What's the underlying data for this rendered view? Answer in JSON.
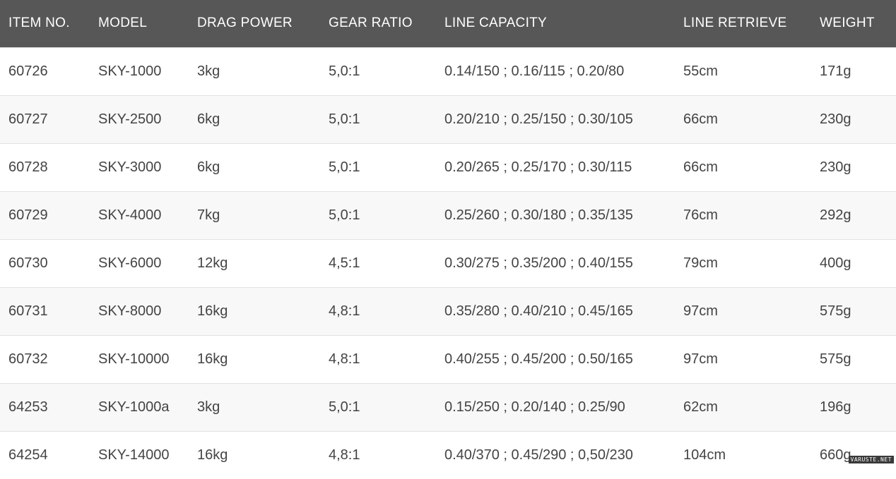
{
  "table": {
    "headers": [
      "ITEM NO.",
      "MODEL",
      "DRAG POWER",
      "GEAR RATIO",
      "LINE CAPACITY",
      "LINE RETRIEVE",
      "WEIGHT"
    ],
    "rows": [
      [
        "60726",
        "SKY-1000",
        "3kg",
        "5,0:1",
        "0.14/150 ; 0.16/115 ; 0.20/80",
        "55cm",
        "171g"
      ],
      [
        "60727",
        "SKY-2500",
        "6kg",
        "5,0:1",
        "0.20/210 ; 0.25/150 ; 0.30/105",
        "66cm",
        "230g"
      ],
      [
        "60728",
        "SKY-3000",
        "6kg",
        "5,0:1",
        "0.20/265 ; 0.25/170 ; 0.30/115",
        "66cm",
        "230g"
      ],
      [
        "60729",
        "SKY-4000",
        "7kg",
        "5,0:1",
        "0.25/260 ; 0.30/180 ; 0.35/135",
        "76cm",
        "292g"
      ],
      [
        "60730",
        "SKY-6000",
        "12kg",
        "4,5:1",
        "0.30/275 ; 0.35/200 ; 0.40/155",
        "79cm",
        "400g"
      ],
      [
        "60731",
        "SKY-8000",
        "16kg",
        "4,8:1",
        "0.35/280 ; 0.40/210 ; 0.45/165",
        "97cm",
        "575g"
      ],
      [
        "60732",
        "SKY-10000",
        "16kg",
        "4,8:1",
        "0.40/255 ; 0.45/200 ; 0.50/165",
        "97cm",
        "575g"
      ],
      [
        "64253",
        "SKY-1000a",
        "3kg",
        "5,0:1",
        "0.15/250 ; 0.20/140 ; 0.25/90",
        "62cm",
        "196g"
      ],
      [
        "64254",
        "SKY-14000",
        "16kg",
        "4,8:1",
        "0.40/370 ; 0.45/290 ; 0,50/230",
        "104cm",
        "660g"
      ]
    ]
  },
  "watermark": "VARUSTE.NET",
  "colors": {
    "header_bg": "#575757",
    "header_text": "#ffffff",
    "row_alt_bg": "#f8f8f8",
    "cell_text": "#444444"
  }
}
